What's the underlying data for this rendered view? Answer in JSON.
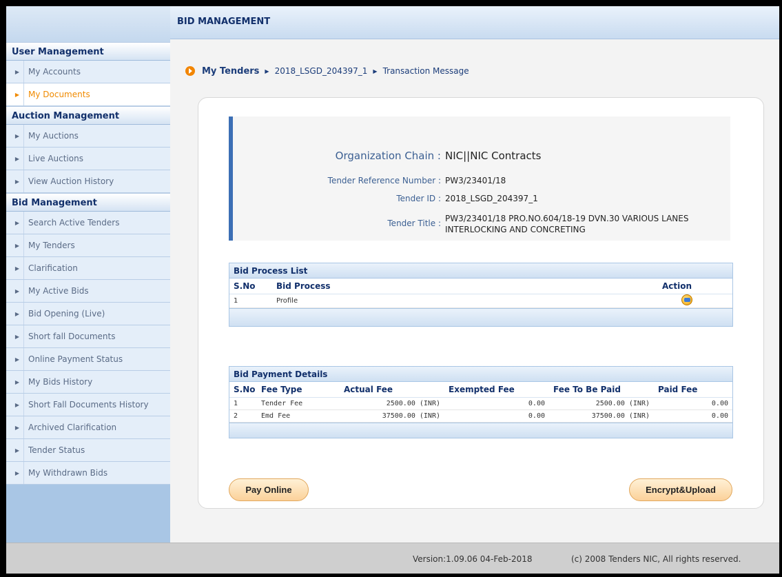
{
  "header": {
    "title": "BID MANAGEMENT"
  },
  "sidebar": {
    "sections": [
      {
        "title": "User Management",
        "items": [
          "My Accounts",
          "My Documents"
        ]
      },
      {
        "title": "Auction Management",
        "items": [
          "My Auctions",
          "Live Auctions",
          "View Auction History"
        ]
      },
      {
        "title": "Bid Management",
        "items": [
          "Search Active Tenders",
          "My Tenders",
          "Clarification",
          "My Active Bids",
          "Bid Opening (Live)",
          "Short fall Documents",
          "Online Payment Status",
          "My Bids History",
          "Short Fall Documents History",
          "Archived Clarification",
          "Tender Status",
          "My Withdrawn Bids"
        ]
      }
    ],
    "active_item": "My Documents"
  },
  "breadcrumb": {
    "root": "My Tenders",
    "tender": "2018_LSGD_204397_1",
    "current": "Transaction Message"
  },
  "tender_info": {
    "org_label": "Organization Chain :",
    "org_value": "NIC||NIC Contracts",
    "ref_label": "Tender Reference Number :",
    "ref_value": "PW3/23401/18",
    "id_label": "Tender ID :",
    "id_value": "2018_LSGD_204397_1",
    "title_label": "Tender Title :",
    "title_line1": "PW3/23401/18 PRO.NO.604/18-19 DVN.30 VARIOUS LANES",
    "title_line2": "INTERLOCKING AND CONCRETING"
  },
  "bid_process_list": {
    "title": "Bid Process List",
    "columns": {
      "sno": "S.No",
      "process": "Bid Process",
      "action": "Action"
    },
    "rows": [
      {
        "sno": "1",
        "process": "Profile",
        "action_icon": "edit-icon"
      }
    ]
  },
  "bid_payment_details": {
    "title": "Bid Payment Details",
    "columns": {
      "sno": "S.No",
      "fee_type": "Fee Type",
      "actual": "Actual Fee",
      "exempted": "Exempted Fee",
      "to_pay": "Fee To Be Paid",
      "paid": "Paid Fee"
    },
    "rows": [
      {
        "sno": "1",
        "fee_type": "Tender Fee",
        "actual": "2500.00 (INR)",
        "exempted": "0.00",
        "to_pay": "2500.00 (INR)",
        "paid": "0.00"
      },
      {
        "sno": "2",
        "fee_type": "Emd Fee",
        "actual": "37500.00 (INR)",
        "exempted": "0.00",
        "to_pay": "37500.00 (INR)",
        "paid": "0.00"
      }
    ]
  },
  "buttons": {
    "pay": "Pay Online",
    "encrypt": "Encrypt&Upload"
  },
  "footer": {
    "version": "Version:1.09.06 04-Feb-2018",
    "copyright": "(c) 2008 Tenders NIC, All rights reserved."
  }
}
